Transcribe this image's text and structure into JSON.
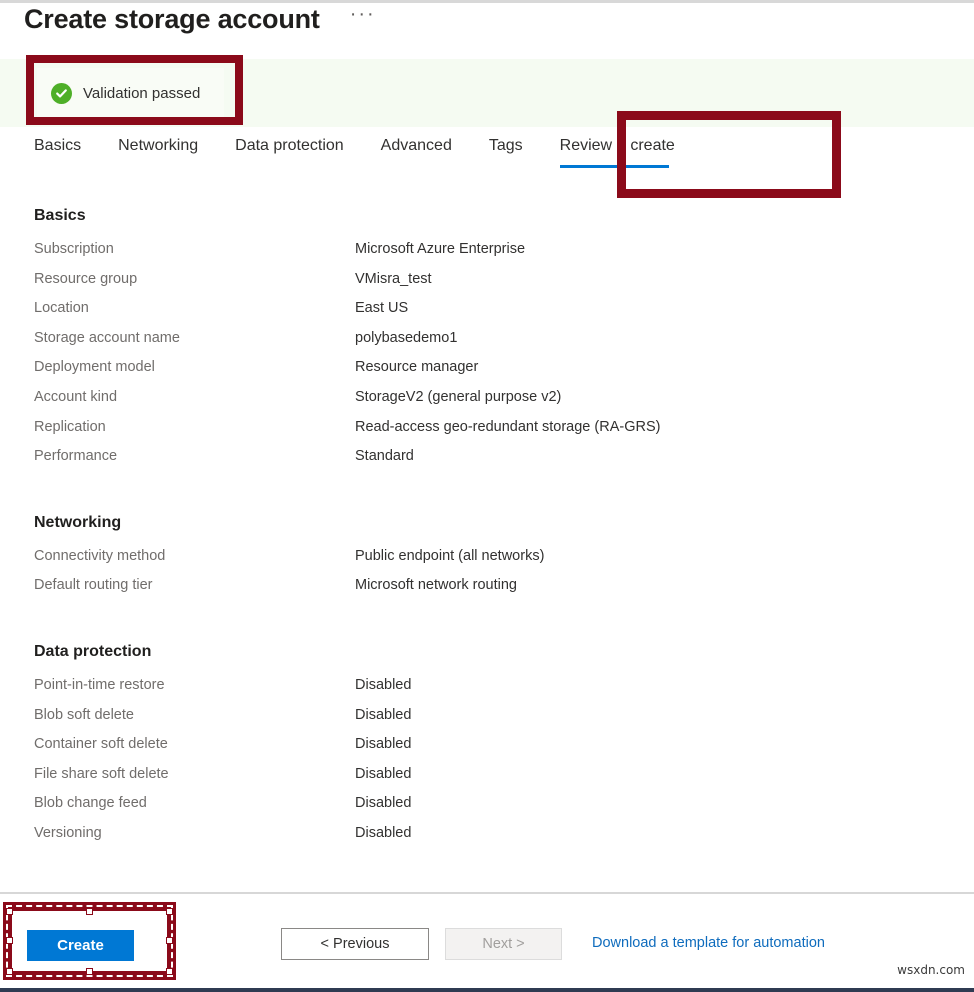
{
  "page": {
    "title": "Create storage account",
    "more_options_icon": "ellipsis-icon",
    "more_options_label": "···"
  },
  "validation": {
    "icon": "check-circle-icon",
    "text": "Validation passed",
    "banner_bg": "#f5fbf2",
    "icon_color": "#4eaf28",
    "highlight_color": "#8b0a1a"
  },
  "tabs": [
    {
      "label": "Basics",
      "active": false
    },
    {
      "label": "Networking",
      "active": false
    },
    {
      "label": "Data protection",
      "active": false
    },
    {
      "label": "Advanced",
      "active": false
    },
    {
      "label": "Tags",
      "active": false
    },
    {
      "label": "Review + create",
      "active": true
    }
  ],
  "active_tab_underline_color": "#0078d4",
  "sections": [
    {
      "heading": "Basics",
      "rows": [
        {
          "label": "Subscription",
          "value": "Microsoft Azure Enterprise"
        },
        {
          "label": "Resource group",
          "value": "VMisra_test"
        },
        {
          "label": "Location",
          "value": "East US"
        },
        {
          "label": "Storage account name",
          "value": "polybasedemo1"
        },
        {
          "label": "Deployment model",
          "value": "Resource manager"
        },
        {
          "label": "Account kind",
          "value": "StorageV2 (general purpose v2)"
        },
        {
          "label": "Replication",
          "value": "Read-access geo-redundant storage (RA-GRS)"
        },
        {
          "label": "Performance",
          "value": "Standard"
        }
      ]
    },
    {
      "heading": "Networking",
      "rows": [
        {
          "label": "Connectivity method",
          "value": "Public endpoint (all networks)"
        },
        {
          "label": "Default routing tier",
          "value": "Microsoft network routing"
        }
      ]
    },
    {
      "heading": "Data protection",
      "rows": [
        {
          "label": "Point-in-time restore",
          "value": "Disabled"
        },
        {
          "label": "Blob soft delete",
          "value": "Disabled"
        },
        {
          "label": "Container soft delete",
          "value": "Disabled"
        },
        {
          "label": "File share soft delete",
          "value": "Disabled"
        },
        {
          "label": "Blob change feed",
          "value": "Disabled"
        },
        {
          "label": "Versioning",
          "value": "Disabled"
        }
      ]
    }
  ],
  "footer": {
    "create_label": "Create",
    "previous_label": "< Previous",
    "next_label": "Next >",
    "next_disabled": true,
    "download_link_label": "Download a template for automation",
    "create_button_color": "#0078d4",
    "link_color": "#0f6cbd"
  },
  "watermark": "wsxdn.com"
}
